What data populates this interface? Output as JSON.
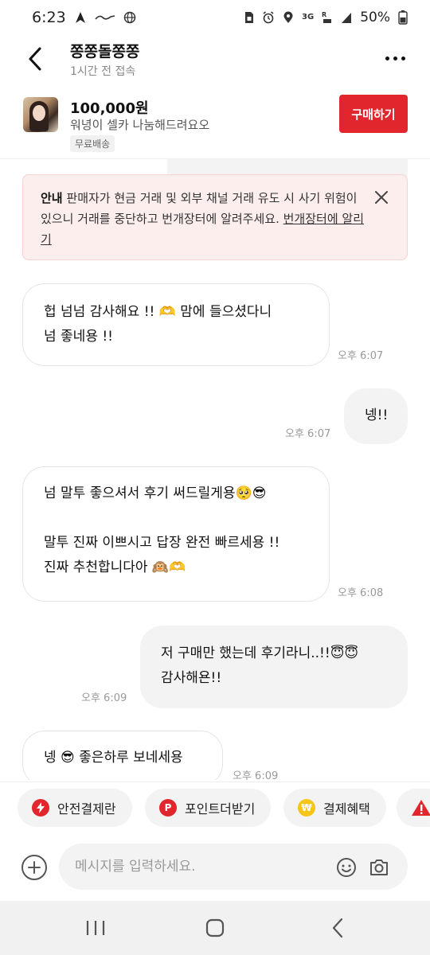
{
  "status_bar": {
    "time": "6:23",
    "battery": "50%",
    "network": "3G",
    "icons": [
      "navigation-icon",
      "carrier-icon",
      "globe-icon",
      "sim-icon",
      "alarm-icon",
      "location-icon",
      "wifi-icon",
      "signal-icon",
      "battery-icon"
    ]
  },
  "header": {
    "title": "쫑쫑돌쫑쫑",
    "subtitle": "1시간 전 접속"
  },
  "product": {
    "price": "100,000원",
    "name": "워녕이 셀카 나눔해드려요오",
    "shipping_badge": "무료배송",
    "buy_label": "구매하기"
  },
  "notice": {
    "label": "안내",
    "text": "판매자가 현금 거래 및 외부 채널 거래 유도 시 사기 위험이 있으니 거래를 중단하고 번개장터에 알려주세요.",
    "link": "번개장터에 알리기"
  },
  "messages": [
    {
      "side": "in",
      "lines": [
        "헙 넘넘 감사해요 !! 🫶 맘에 들으셨다니",
        "넘 좋네용 !!"
      ],
      "time": "오후 6:07"
    },
    {
      "side": "out",
      "lines": [
        "넹!!"
      ],
      "time": "오후 6:07"
    },
    {
      "side": "in",
      "lines": [
        "넘 말투 좋으셔서 후기 써드릴게용🥺😎",
        "",
        "말투 진짜 이쁘시고 답장 완전 빠르세용 !!",
        "진짜 추천합니다아 🙉🫶"
      ],
      "time": "오후 6:08"
    },
    {
      "side": "out",
      "lines": [
        "저 구매만 했는데 후기라니..!!😇😇",
        "감사해욘!!"
      ],
      "time": "오후 6:09"
    },
    {
      "side": "in",
      "lines": [
        "넹 😎 좋은하루 보네세용"
      ],
      "time": "오후 6:09"
    }
  ],
  "chips": [
    {
      "label": "안전결제란",
      "icon": "lightning-icon",
      "color": "#e2262d"
    },
    {
      "label": "포인트더받기",
      "icon": "point-icon",
      "color": "#e2262d"
    },
    {
      "label": "결제혜택",
      "icon": "won-coin-icon",
      "color": "#f5c518"
    },
    {
      "label": "",
      "icon": "warning-icon",
      "color": "#e2262d"
    }
  ],
  "input": {
    "placeholder": "메시지를 입력하세요."
  },
  "colors": {
    "accent": "#e2262d",
    "notice_bg": "#fdeeee",
    "bubble_out": "#f3f3f3"
  }
}
